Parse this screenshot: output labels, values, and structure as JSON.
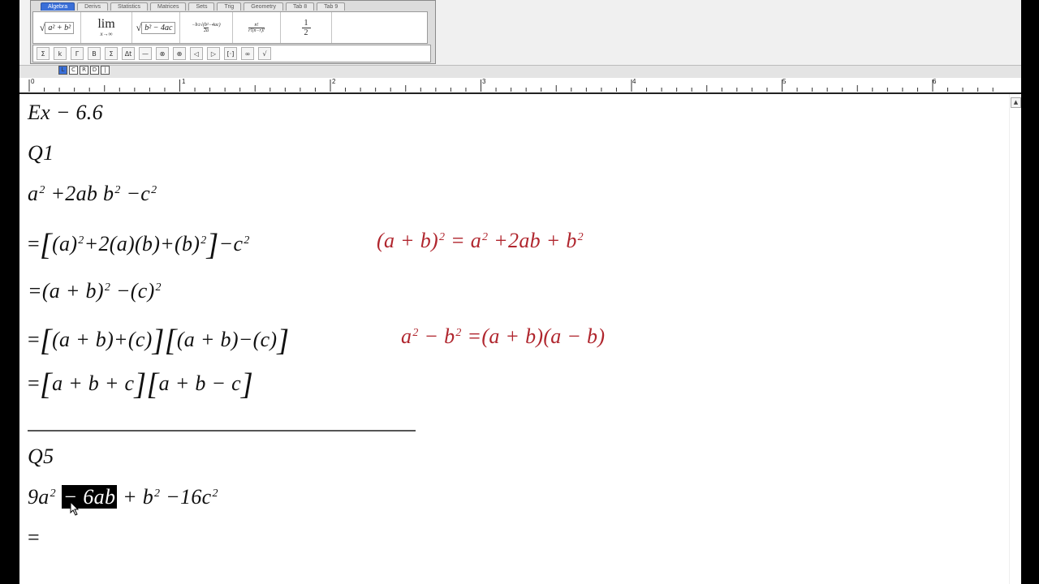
{
  "palette": {
    "tabs": [
      "Algebra",
      "Derivs",
      "Statistics",
      "Matrices",
      "Sets",
      "Trig",
      "Geometry",
      "Tab 8",
      "Tab 9"
    ],
    "active_tab": "Algebra",
    "templates": {
      "sqrt_sum": "a² + b²",
      "lim_main": "lim",
      "lim_sub": "x→∞",
      "sqrt_disc": "b² − 4ac",
      "quadratic_top": "−b±√(b²−4ac)",
      "quadratic_bottom": "2a",
      "nCr_top": "n!",
      "nCr_bottom": "r!(n−r)!",
      "half_num": "1",
      "half_den": "2"
    },
    "symbols": [
      "Σ",
      "k",
      "Γ",
      "B",
      "Σ",
      "Δt",
      "—",
      "⊗",
      "⊕",
      "◁",
      "▷",
      "[·]",
      "∞",
      "√"
    ]
  },
  "ruler": {
    "labels": [
      "0",
      "1",
      "2",
      "3",
      "4",
      "5",
      "6"
    ]
  },
  "tabstops": [
    "L",
    "C",
    "R",
    "D",
    "|"
  ],
  "document": {
    "heading": "Ex − 6.6",
    "q1_label": "Q1",
    "q1_expr": {
      "a": "a",
      "p2": "+2ab",
      "b": "b",
      "m": "−c"
    },
    "q1_step1_left": "(a)",
    "q1_step1_mid": "+2(a)(b)+(b)",
    "q1_step1_tail": "−c",
    "q1_identity1_lhs": "(a + b)",
    "q1_identity1_rhs_a": "= a",
    "q1_identity1_rhs_mid": "+2ab + b",
    "q1_step2_a": "=(a + b)",
    "q1_step2_b": "−(c)",
    "q1_step3_a": "(a + b)+(c)",
    "q1_step3_b": "(a + b)−(c)",
    "q1_identity2_a": "a",
    "q1_identity2_b": "− b",
    "q1_identity2_c": "=(a + b)(a − b)",
    "q1_step4_a": "a + b + c",
    "q1_step4_b": "a + b − c",
    "q5_label": "Q5",
    "q5_expr_a": "9a",
    "q5_expr_selected": "− 6ab",
    "q5_expr_b": "+ b",
    "q5_expr_c": "−16c",
    "q5_next": "=",
    "exponent": "2",
    "equals": "=",
    "lbracket": "[",
    "rbracket": "]"
  }
}
